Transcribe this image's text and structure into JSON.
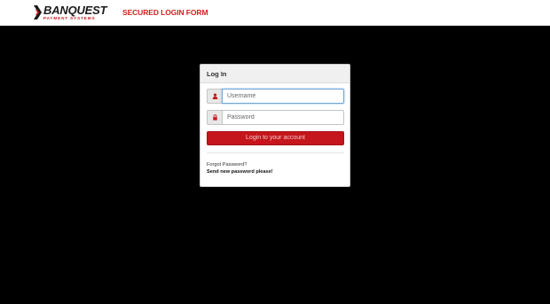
{
  "header": {
    "brand_name": "BANQUEST",
    "brand_tagline": "PAYMENT SYSTEMS",
    "form_title": "SECURED LOGIN FORM"
  },
  "login_panel": {
    "title": "Log In",
    "username": {
      "placeholder": "Username",
      "value": "",
      "icon": "user-icon"
    },
    "password": {
      "placeholder": "Password",
      "value": "",
      "icon": "lock-icon"
    },
    "submit_label": "Login to your account",
    "forgot_text": "Forgot Password?",
    "send_password_link": "Send new password please!"
  },
  "colors": {
    "page_background": "#000000",
    "accent_red": "#c4161c",
    "header_background": "#ffffff"
  }
}
